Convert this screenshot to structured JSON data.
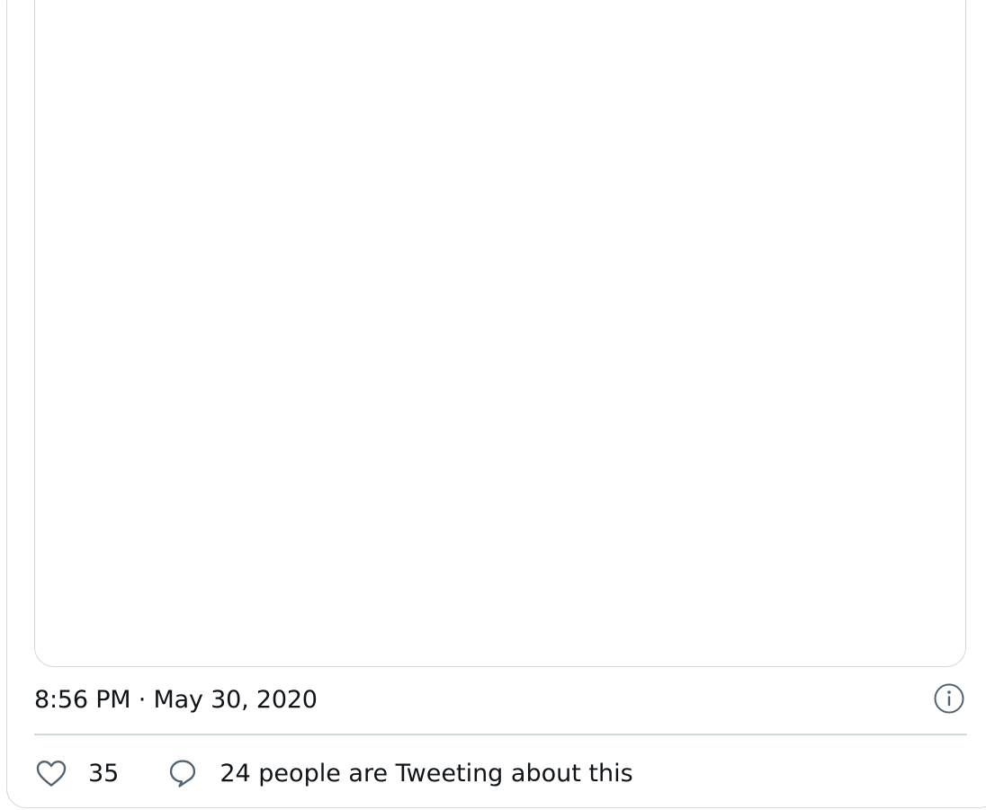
{
  "tweet": {
    "timestamp": "8:56 PM · May 30, 2020",
    "info_icon": "info-circle-icon",
    "likes": {
      "icon": "heart-outline-icon",
      "count": "35"
    },
    "conversation": {
      "icon": "speech-bubble-icon",
      "label": "24 people are Tweeting about this"
    },
    "colors": {
      "text": "#0f1419",
      "icon": "#536471",
      "border": "#cfd9de"
    }
  }
}
